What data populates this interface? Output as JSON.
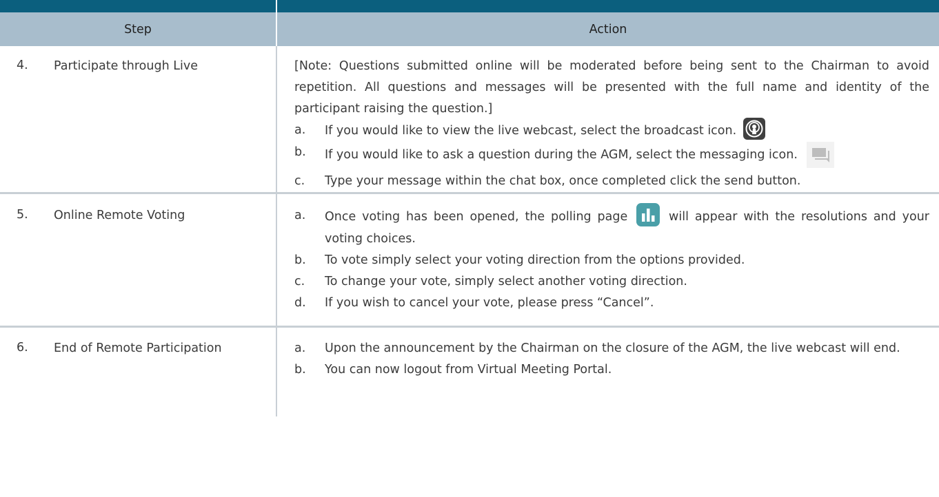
{
  "header": {
    "step": "Step",
    "action": "Action"
  },
  "rows": [
    {
      "num": "4.",
      "label": "Participate through Live",
      "note": "[Note: Questions submitted online will be moderated before being sent to the Chairman to avoid repetition. All questions and messages will be presented with the full name and identity of the participant raising the question.]",
      "items": [
        {
          "letter": "a.",
          "text": "If you would like to view the live webcast, select the broadcast icon."
        },
        {
          "letter": "b.",
          "text": "If you would like to ask a question during the AGM, select the messaging icon."
        },
        {
          "letter": "c.",
          "text": "Type your message within the chat box, once completed click the send button."
        }
      ]
    },
    {
      "num": "5.",
      "label": "Online Remote Voting",
      "items": [
        {
          "letter": "a.",
          "text_before": "Once voting has been opened, the polling page",
          "text_after": "will appear with the resolutions and your voting choices."
        },
        {
          "letter": "b.",
          "text": "To vote simply select your voting direction from the options provided."
        },
        {
          "letter": "c.",
          "text": "To change your vote, simply select another voting direction."
        },
        {
          "letter": "d.",
          "text": "If you wish to cancel your vote, please press “Cancel”."
        }
      ]
    },
    {
      "num": "6.",
      "label": "End of Remote Participation",
      "items": [
        {
          "letter": "a.",
          "text": "Upon the announcement by the Chairman on the closure of the AGM, the live webcast will end."
        },
        {
          "letter": "b.",
          "text": "You can now logout from Virtual Meeting Portal."
        }
      ]
    }
  ],
  "icons": {
    "broadcast": "broadcast-icon",
    "messaging": "messaging-icon",
    "polling": "polling-icon"
  },
  "colors": {
    "top_bar": "#0b5f7e",
    "header_bg": "#a8bdcc",
    "poll_icon": "#4a9fa8"
  }
}
